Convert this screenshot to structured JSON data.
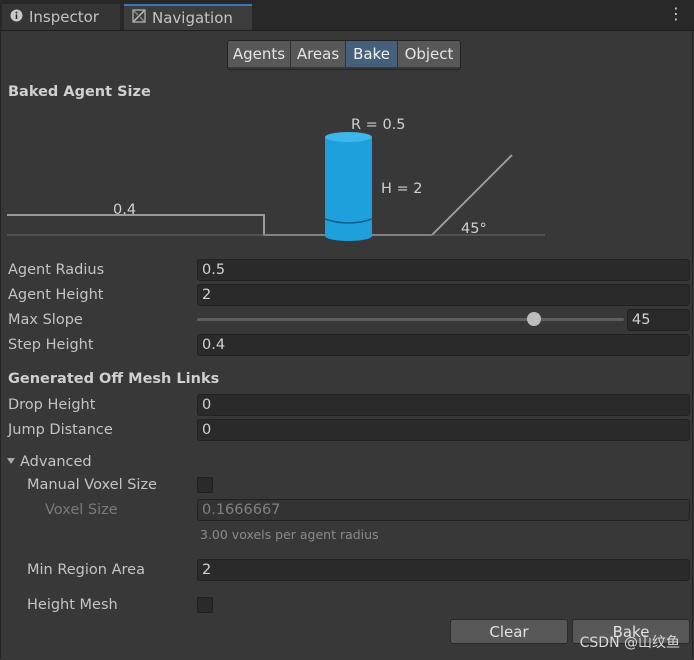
{
  "tabs": [
    {
      "label": "Inspector",
      "icon": "info-icon"
    },
    {
      "label": "Navigation",
      "icon": "navigation-icon"
    }
  ],
  "segments": [
    "Agents",
    "Areas",
    "Bake",
    "Object"
  ],
  "selected_segment": "Bake",
  "baked_agent_size": {
    "header": "Baked Agent Size",
    "diagram": {
      "radius_label": "R = 0.5",
      "height_label": "H = 2",
      "step_label": "0.4",
      "slope_label": "45°",
      "cylinder_color": "#1ea0dd"
    }
  },
  "fields": {
    "agent_radius": {
      "label": "Agent Radius",
      "value": "0.5"
    },
    "agent_height": {
      "label": "Agent Height",
      "value": "2"
    },
    "max_slope": {
      "label": "Max Slope",
      "value": "45",
      "slider_fraction": 0.8
    },
    "step_height": {
      "label": "Step Height",
      "value": "0.4"
    }
  },
  "off_mesh": {
    "header": "Generated Off Mesh Links",
    "drop_height": {
      "label": "Drop Height",
      "value": "0"
    },
    "jump_distance": {
      "label": "Jump Distance",
      "value": "0"
    }
  },
  "advanced": {
    "label": "Advanced",
    "manual_voxel_size": {
      "label": "Manual Voxel Size",
      "checked": false
    },
    "voxel_size": {
      "label": "Voxel Size",
      "value": "0.1666667",
      "note": "3.00 voxels per agent radius"
    },
    "min_region_area": {
      "label": "Min Region Area",
      "value": "2"
    },
    "height_mesh": {
      "label": "Height Mesh",
      "checked": false
    }
  },
  "buttons": {
    "clear": "Clear",
    "bake": "Bake"
  },
  "watermark": "CSDN @山纹鱼"
}
